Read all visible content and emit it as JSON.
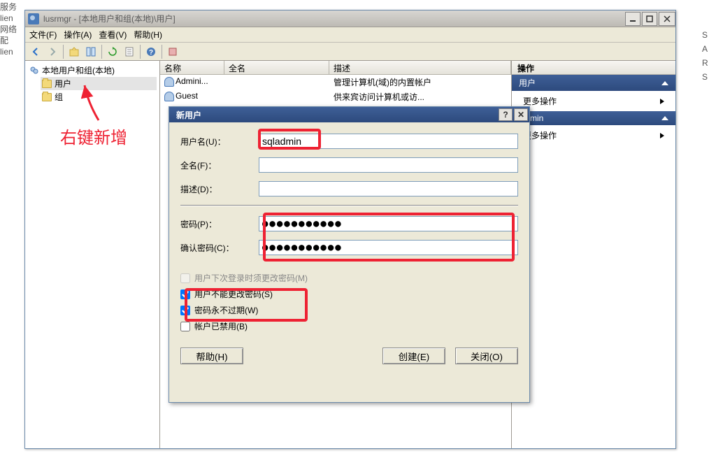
{
  "bg": {
    "left_lines": [
      "服务",
      "lien",
      "网络配",
      "lien"
    ],
    "right_lines": [
      "S",
      "A",
      "R",
      "",
      "S"
    ]
  },
  "window": {
    "title": "lusrmgr - [本地用户和组(本地)\\用户]",
    "menus": {
      "file": "文件(F)",
      "action": "操作(A)",
      "view": "查看(V)",
      "help": "帮助(H)"
    }
  },
  "tree": {
    "root": "本地用户和组(本地)",
    "users": "用户",
    "groups": "组",
    "annotation": "右键新增"
  },
  "list": {
    "headers": {
      "name": "名称",
      "fullname": "全名",
      "desc": "描述"
    },
    "rows": [
      {
        "name": "Admini...",
        "fullname": "",
        "desc": "管理计算机(域)的内置帐户"
      },
      {
        "name": "Guest",
        "fullname": "",
        "desc": "供来宾访问计算机或访..."
      }
    ]
  },
  "actions": {
    "header": "操作",
    "section1": "用户",
    "more1": "更多操作",
    "section2": "ladmin",
    "more2": "更多操作"
  },
  "dialog": {
    "title": "新用户",
    "labels": {
      "username": "用户名(U)：",
      "fullname": "全名(F)：",
      "desc": "描述(D)：",
      "password": "密码(P)：",
      "confirm": "确认密码(C)："
    },
    "values": {
      "username": "sqladmin",
      "fullname": "",
      "desc": "",
      "password": "●●●●●●●●●●●",
      "confirm": "●●●●●●●●●●●"
    },
    "checkboxes": {
      "must_change": "用户下次登录时须更改密码(M)",
      "cannot_change": "用户不能更改密码(S)",
      "never_expire": "密码永不过期(W)",
      "disabled": "帐户已禁用(B)"
    },
    "buttons": {
      "help": "帮助(H)",
      "create": "创建(E)",
      "close": "关闭(O)"
    }
  }
}
